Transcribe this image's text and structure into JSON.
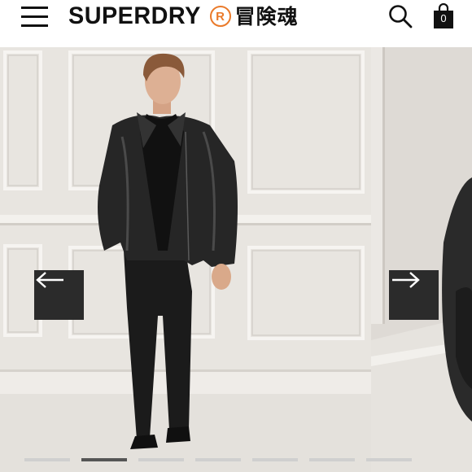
{
  "header": {
    "brand_name": "SUPERDRY",
    "brand_registered": "R",
    "brand_japanese": "冒険魂",
    "cart_count": "0",
    "icons": [
      "menu-icon",
      "search-icon",
      "bag-icon"
    ]
  },
  "carousel": {
    "prev_icon": "arrow-left-icon",
    "next_icon": "arrow-right-icon",
    "slide_count": 7,
    "active_slide": 2
  },
  "colors": {
    "brand_accent": "#ea7a2a",
    "arrow_button_bg": "#2b2b2b",
    "text": "#111111"
  }
}
